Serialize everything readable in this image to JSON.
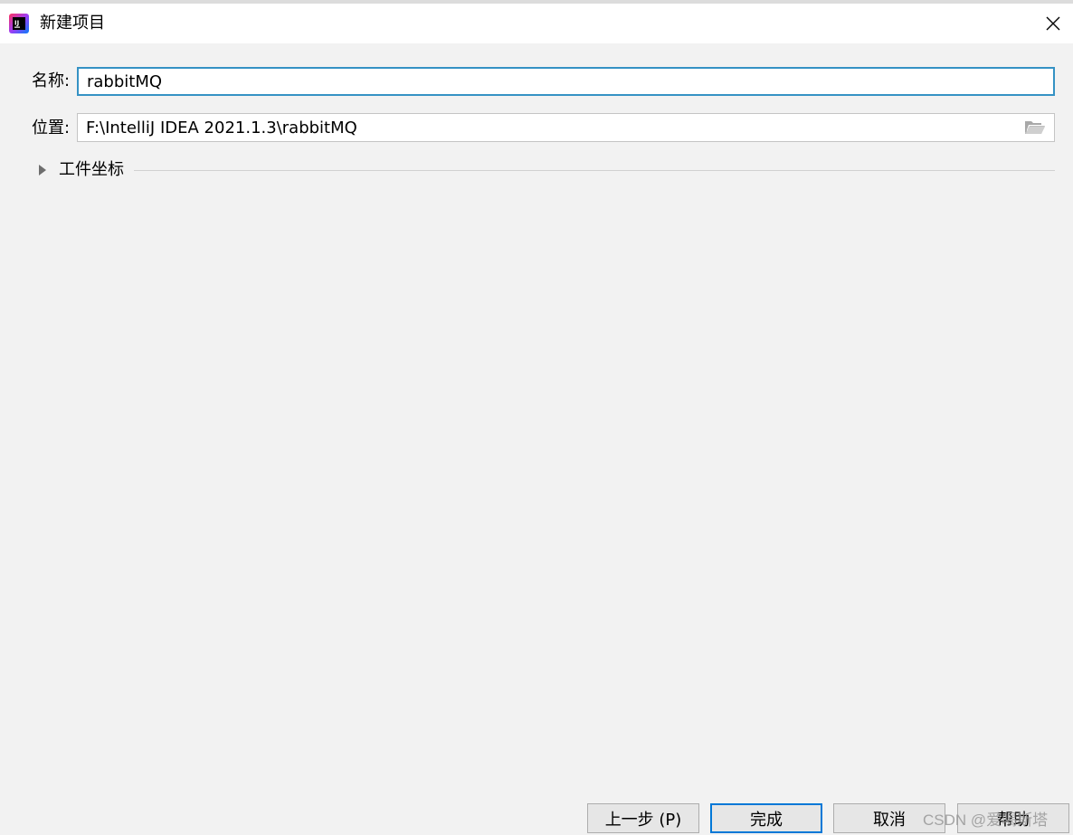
{
  "window": {
    "title": "新建项目",
    "app_icon": "intellij-idea-icon",
    "close_icon": "close-icon"
  },
  "form": {
    "name_label": "名称:",
    "name_value": "rabbitMQ",
    "location_label": "位置:",
    "location_value": "F:\\IntelliJ IDEA 2021.1.3\\rabbitMQ",
    "location_browse_icon": "folder-open-icon",
    "artifact_section": {
      "label": "工件坐标",
      "expanded": false,
      "icon": "expand-triangle-icon"
    }
  },
  "buttons": {
    "prev": "上一步 (P)",
    "finish": "完成",
    "cancel": "取消",
    "help": "帮助"
  },
  "watermark": "CSDN @爱喝斯塔",
  "colors": {
    "focus_border": "#3592c4",
    "default_button_border": "#0078d7",
    "background": "#f2f2f2"
  }
}
